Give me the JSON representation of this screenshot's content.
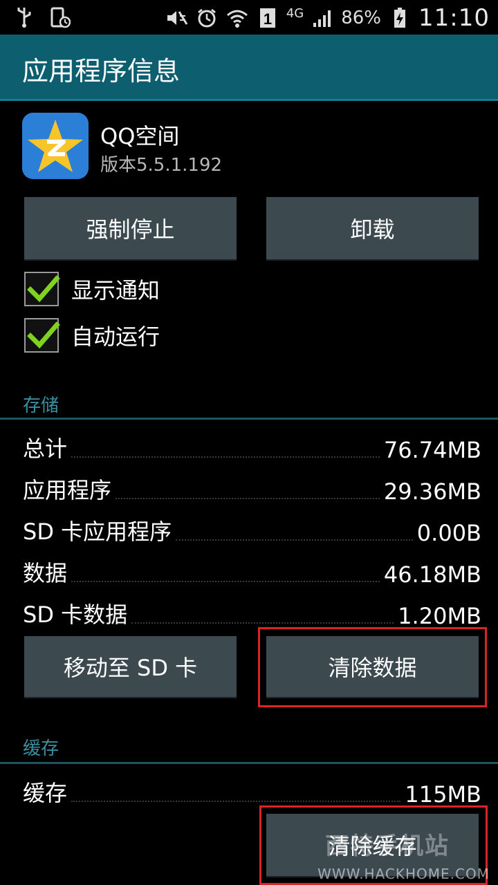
{
  "status_bar": {
    "left_icons": [
      "usb-icon",
      "screen-timer-icon"
    ],
    "right_icons": [
      "mute-icon",
      "alarm-icon",
      "wifi-icon",
      "sim-1-icon",
      "signal-icon"
    ],
    "network": "4G",
    "battery": "86%",
    "time": "11:10"
  },
  "header": {
    "title": "应用程序信息"
  },
  "app": {
    "name": "QQ空间",
    "version": "版本5.5.1.192"
  },
  "actions": {
    "force_stop": "强制停止",
    "uninstall": "卸载"
  },
  "checkboxes": [
    {
      "label": "显示通知",
      "checked": true
    },
    {
      "label": "自动运行",
      "checked": true
    }
  ],
  "storage": {
    "section_label": "存储",
    "rows": [
      {
        "label": "总计",
        "value": "76.74MB"
      },
      {
        "label": "应用程序",
        "value": "29.36MB"
      },
      {
        "label": "SD 卡应用程序",
        "value": "0.00B"
      },
      {
        "label": "数据",
        "value": "46.18MB"
      },
      {
        "label": "SD 卡数据",
        "value": "1.20MB"
      }
    ],
    "move_button": "移动至 SD 卡",
    "clear_data_button": "清除数据"
  },
  "cache": {
    "section_label": "缓存",
    "row": {
      "label": "缓存",
      "value": "115MB"
    },
    "clear_cache_button": "清除缓存"
  },
  "watermark": {
    "logo_text": "西特手机站",
    "site": "WWW.HACKHOME.COM"
  },
  "colors": {
    "titlebar": "#0d5f6f",
    "button": "#3c4a50",
    "section_label": "#3a8fa0",
    "checkmark": "#7ed321",
    "highlight": "#d92525"
  }
}
